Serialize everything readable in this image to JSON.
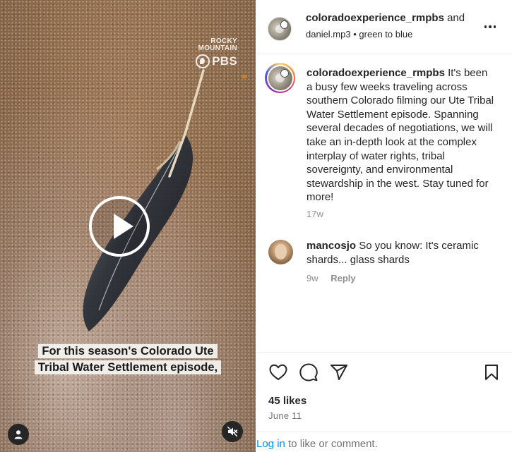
{
  "video": {
    "brand_line1": "ROCKY",
    "brand_line2": "MOUNTAIN",
    "brand_pbs": "PBS",
    "caption_line1": "For this season's Colorado Ute",
    "caption_line2": "Tribal Water Settlement episode,",
    "icons": {
      "play": "play-icon",
      "user": "user-icon",
      "mute": "muted-speaker-icon"
    }
  },
  "header": {
    "username": "coloradoexperience_rmpbs",
    "and_text": "and",
    "audio_artist": "daniel.mp3",
    "separator": "•",
    "audio_title": "green to blue",
    "more_icon": "more-horizontal-icon"
  },
  "comments": [
    {
      "username": "coloradoexperience_rmpbs",
      "text": "It's been a busy few weeks traveling across southern Colorado filming our Ute Tribal Water Settlement episode. Spanning several decades of negotiations, we will take an in-depth look at the complex interplay of water rights, tribal sovereignty, and environmental stewardship in the west. Stay tuned for more!",
      "time": "17w"
    },
    {
      "username": "mancosjo",
      "text": "So you know: It's ceramic shards... glass shards",
      "time": "9w",
      "reply_label": "Reply"
    }
  ],
  "actions": {
    "icons": [
      "heart-icon",
      "comment-icon",
      "share-icon",
      "bookmark-icon"
    ],
    "likes": "45 likes",
    "date": "June 11"
  },
  "login": {
    "link": "Log in",
    "rest": "to like or comment."
  },
  "colors": {
    "link_blue": "#0095f6",
    "text": "#262626",
    "muted": "#8e8e8e",
    "divider": "#efefef"
  }
}
